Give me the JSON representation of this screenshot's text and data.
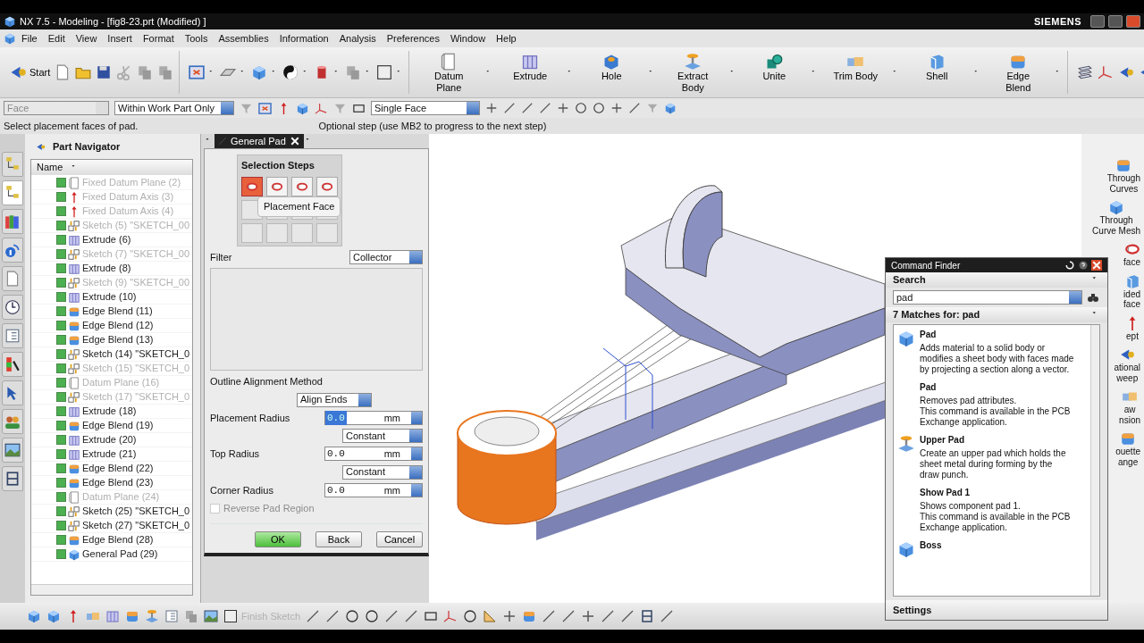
{
  "window": {
    "title": "NX 7.5 - Modeling - [fig8-23.prt (Modified) ]",
    "brand": "SIEMENS"
  },
  "menu": [
    "File",
    "Edit",
    "View",
    "Insert",
    "Format",
    "Tools",
    "Assemblies",
    "Information",
    "Analysis",
    "Preferences",
    "Window",
    "Help"
  ],
  "toolbar": {
    "start": "Start",
    "commands": [
      {
        "label": "Datum Plane",
        "kind": "plane"
      },
      {
        "label": "Extrude",
        "kind": "extrude"
      },
      {
        "label": "Hole",
        "kind": "hole"
      },
      {
        "label": "Extract Body",
        "kind": "extract"
      },
      {
        "label": "Unite",
        "kind": "unite"
      },
      {
        "label": "Trim Body",
        "kind": "trim"
      },
      {
        "label": "Shell",
        "kind": "shell"
      },
      {
        "label": "Edge Blend",
        "kind": "blend"
      }
    ]
  },
  "selection_bar": {
    "type_filter": {
      "placeholder": "Face",
      "disabled": true
    },
    "scope": "Within Work Part Only",
    "rule": "Single Face"
  },
  "status": {
    "prompt": "Select placement faces of pad.",
    "hint": "Optional step (use MB2 to progress to the next step)"
  },
  "resource_tabs": [
    {
      "selected": false
    },
    {
      "selected": true
    },
    {
      "selected": false
    },
    {
      "selected": false
    },
    {
      "selected": false
    },
    {
      "selected": false
    },
    {
      "selected": false
    },
    {
      "selected": false
    },
    {
      "selected": false
    },
    {
      "selected": false
    },
    {
      "selected": false
    },
    {
      "selected": false
    }
  ],
  "part_navigator": {
    "title": "Part Navigator",
    "column": "Name",
    "items": [
      {
        "label": "Fixed Datum Plane (2)",
        "kind": "datum-plane",
        "checked": true,
        "dimmed": true
      },
      {
        "label": "Fixed Datum Axis (3)",
        "kind": "datum-axis",
        "checked": true,
        "dimmed": true
      },
      {
        "label": "Fixed Datum Axis (4)",
        "kind": "datum-axis",
        "checked": true,
        "dimmed": true
      },
      {
        "label": "Sketch (5) \"SKETCH_00",
        "kind": "sketch",
        "checked": true,
        "dimmed": true
      },
      {
        "label": "Extrude (6)",
        "kind": "extrude",
        "checked": true,
        "dimmed": false
      },
      {
        "label": "Sketch (7) \"SKETCH_00",
        "kind": "sketch",
        "checked": true,
        "dimmed": true
      },
      {
        "label": "Extrude (8)",
        "kind": "extrude",
        "checked": true,
        "dimmed": false
      },
      {
        "label": "Sketch (9) \"SKETCH_00",
        "kind": "sketch",
        "checked": true,
        "dimmed": true
      },
      {
        "label": "Extrude (10)",
        "kind": "extrude",
        "checked": true,
        "dimmed": false
      },
      {
        "label": "Edge Blend (11)",
        "kind": "blend",
        "checked": true,
        "dimmed": false
      },
      {
        "label": "Edge Blend (12)",
        "kind": "blend",
        "checked": true,
        "dimmed": false
      },
      {
        "label": "Edge Blend (13)",
        "kind": "blend",
        "checked": true,
        "dimmed": false
      },
      {
        "label": "Sketch (14) \"SKETCH_0",
        "kind": "sketch",
        "checked": true,
        "dimmed": false
      },
      {
        "label": "Sketch (15) \"SKETCH_0",
        "kind": "sketch",
        "checked": true,
        "dimmed": true
      },
      {
        "label": "Datum Plane (16)",
        "kind": "datum-plane",
        "checked": true,
        "dimmed": true
      },
      {
        "label": "Sketch (17) \"SKETCH_0",
        "kind": "sketch",
        "checked": true,
        "dimmed": true
      },
      {
        "label": "Extrude (18)",
        "kind": "extrude",
        "checked": true,
        "dimmed": false
      },
      {
        "label": "Edge Blend (19)",
        "kind": "blend",
        "checked": true,
        "dimmed": false
      },
      {
        "label": "Extrude (20)",
        "kind": "extrude",
        "checked": true,
        "dimmed": false
      },
      {
        "label": "Extrude (21)",
        "kind": "extrude",
        "checked": true,
        "dimmed": false
      },
      {
        "label": "Edge Blend (22)",
        "kind": "blend",
        "checked": true,
        "dimmed": false
      },
      {
        "label": "Edge Blend (23)",
        "kind": "blend",
        "checked": true,
        "dimmed": false
      },
      {
        "label": "Datum Plane (24)",
        "kind": "datum-plane",
        "checked": true,
        "dimmed": true
      },
      {
        "label": "Sketch (25) \"SKETCH_0",
        "kind": "sketch",
        "checked": true,
        "dimmed": false
      },
      {
        "label": "Sketch (27) \"SKETCH_0",
        "kind": "sketch",
        "checked": true,
        "dimmed": false
      },
      {
        "label": "Edge Blend (28)",
        "kind": "blend",
        "checked": true,
        "dimmed": false
      },
      {
        "label": "General Pad (29)",
        "kind": "pad",
        "checked": true,
        "dimmed": false
      }
    ]
  },
  "dialog": {
    "title": "General Pad",
    "steps_title": "Selection Steps",
    "steps": [
      {
        "selected": true
      },
      {
        "selected": false
      },
      {
        "selected": false
      },
      {
        "selected": false
      }
    ],
    "tooltip": "Placement Face",
    "filter_label": "Filter",
    "filter": "Collector",
    "alignment_label": "Outline Alignment Method",
    "alignment": "Align Ends",
    "fields": [
      {
        "label": "Placement Radius",
        "value": "0.0",
        "unit": "mm",
        "selected": true,
        "law": "Constant"
      },
      {
        "label": "Top Radius",
        "value": "0.0",
        "unit": "mm",
        "selected": false,
        "law": "Constant"
      },
      {
        "label": "Corner Radius",
        "value": "0.0",
        "unit": "mm",
        "selected": false
      }
    ],
    "reverse": {
      "label": "Reverse Pad Region",
      "checked": false,
      "disabled": true
    },
    "buttons": [
      {
        "label": "OK",
        "kind": "default"
      },
      {
        "label": "Back",
        "kind": "normal"
      },
      {
        "label": "Cancel",
        "kind": "normal"
      }
    ]
  },
  "command_finder": {
    "title": "Command Finder",
    "search_label": "Search",
    "query": "pad",
    "matches_label": "7 Matches for: pad",
    "settings_label": "Settings",
    "results": [
      {
        "title": "Pad",
        "kind": "pad",
        "lines": [
          "Adds material to a solid body or",
          "modifies a sheet body with faces made",
          "by projecting a section along a vector."
        ]
      },
      {
        "title": "Pad",
        "kind": "plain",
        "lines": [
          "Removes pad attributes.",
          "This command is available in the PCB",
          "Exchange application."
        ]
      },
      {
        "title": "Upper Pad",
        "kind": "upper",
        "lines": [
          "Create an upper pad which holds the",
          "sheet metal during forming by the",
          "draw punch."
        ]
      },
      {
        "title": "Show Pad 1",
        "kind": "plain",
        "lines": [
          "Shows component pad 1.",
          "This command is available in the PCB",
          "Exchange application."
        ]
      },
      {
        "title": "Boss",
        "kind": "boss"
      }
    ]
  },
  "resource_bar": [
    {
      "lines": [
        "Through",
        "Curves"
      ]
    },
    {
      "lines": [
        "Through",
        "Curve Mesh"
      ]
    },
    {
      "lines": [
        "face"
      ]
    },
    {
      "lines": [
        "ided",
        "face"
      ]
    },
    {
      "lines": [
        "ept"
      ]
    },
    {
      "lines": [
        "ational",
        "weep"
      ]
    },
    {
      "lines": [
        "aw",
        "nsion"
      ]
    },
    {
      "lines": [
        "ouette",
        "ange"
      ]
    }
  ],
  "sketch_toolbar": {
    "finish": "Finish Sketch",
    "finish_disabled": true
  }
}
